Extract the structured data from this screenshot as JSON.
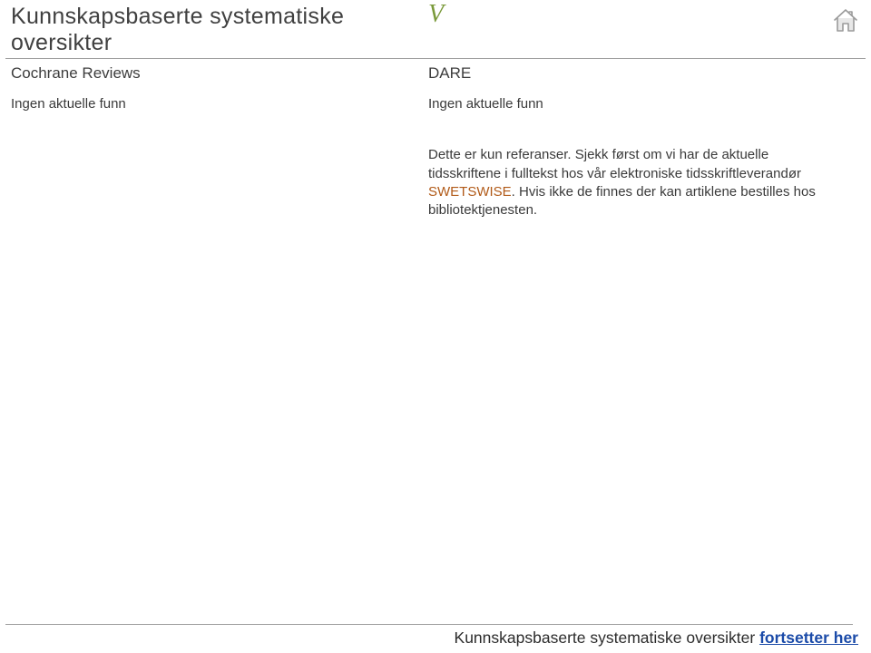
{
  "header": {
    "title": "Kunnskapsbaserte systematiske oversikter",
    "checkmark": "V"
  },
  "columns": {
    "left": {
      "heading": "Cochrane Reviews",
      "body": "Ingen aktuelle funn"
    },
    "right": {
      "heading": "DARE",
      "body": "Ingen aktuelle funn",
      "note_pre": "Dette er kun referanser. Sjekk først om vi har de aktuelle tidsskriftene i fulltekst hos vår elektroniske tidsskriftleverandør ",
      "note_link": "SWETSWISE",
      "note_post": ". Hvis ikke de finnes der kan artiklene bestilles hos bibliotektjenesten."
    }
  },
  "footer": {
    "text": "Kunnskapsbaserte systematiske oversikter ",
    "link": "fortsetter her"
  },
  "icons": {
    "home": "home-icon"
  }
}
